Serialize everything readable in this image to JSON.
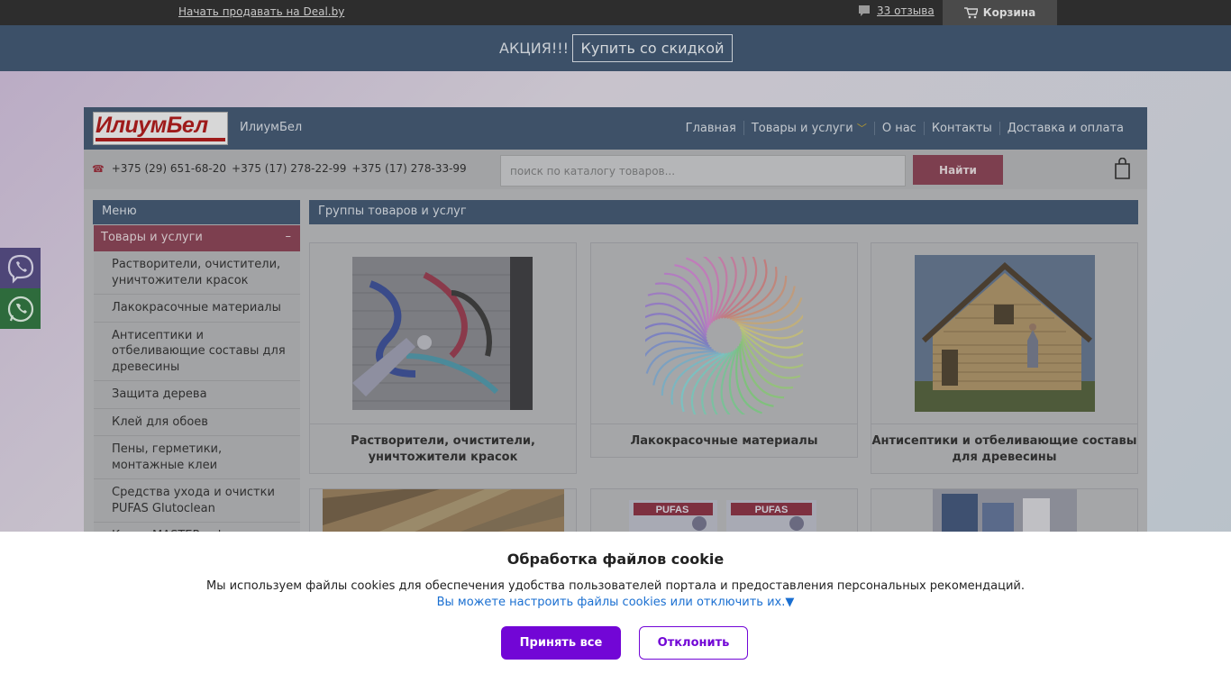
{
  "topbar": {
    "sell_link": "Начать продавать на Deal.by",
    "reviews": "33 отзыва",
    "cart": "Корзина"
  },
  "promo": {
    "text": "АКЦИЯ!!!",
    "button": "Купить со скидкой"
  },
  "header": {
    "logo_text": "ИлиумБел",
    "brand": "ИлиумБел",
    "nav": [
      "Главная",
      "Товары и услуги",
      "О нас",
      "Контакты",
      "Доставка и оплата"
    ]
  },
  "contacts": {
    "phones": [
      "+375 (29) 651-68-20",
      "+375 (17) 278-22-99",
      "+375 (17) 278-33-99"
    ]
  },
  "search": {
    "placeholder": "поиск по каталогу товаров...",
    "button": "Найти"
  },
  "sidebar": {
    "title": "Меню",
    "active": "Товары и услуги",
    "collapse": "–",
    "items": [
      "Растворители, очистители, уничтожители красок",
      "Лакокрасочные материалы",
      "Антисептики и отбеливающие составы для древесины",
      "Защита дерева",
      "Клей для обоев",
      "Пены, герметики, монтажные клеи",
      "Средства ухода и очистки PUFAS Glutoclean",
      "Кисти MASTER color"
    ]
  },
  "main": {
    "title": "Группы товаров и услуг",
    "cards": [
      "Растворители, очистители, уничтожители красок",
      "Лакокрасочные материалы",
      "Антисептики и отбеливающие составы для древесины"
    ],
    "product_labels": [
      "PUFAS",
      "PUFAS"
    ]
  },
  "cookie": {
    "title": "Обработка файлов cookie",
    "text": "Мы используем файлы cookies для обеспечения удобства пользователей портала и предоставления персональных рекомендаций.",
    "link": "Вы можете настроить файлы cookies или отключить их.▼",
    "accept": "Принять все",
    "reject": "Отклонить"
  },
  "colors": {
    "accent_purple": "#7206d6",
    "header_blue": "#3e5168",
    "brand_red": "#9e1a1a"
  }
}
